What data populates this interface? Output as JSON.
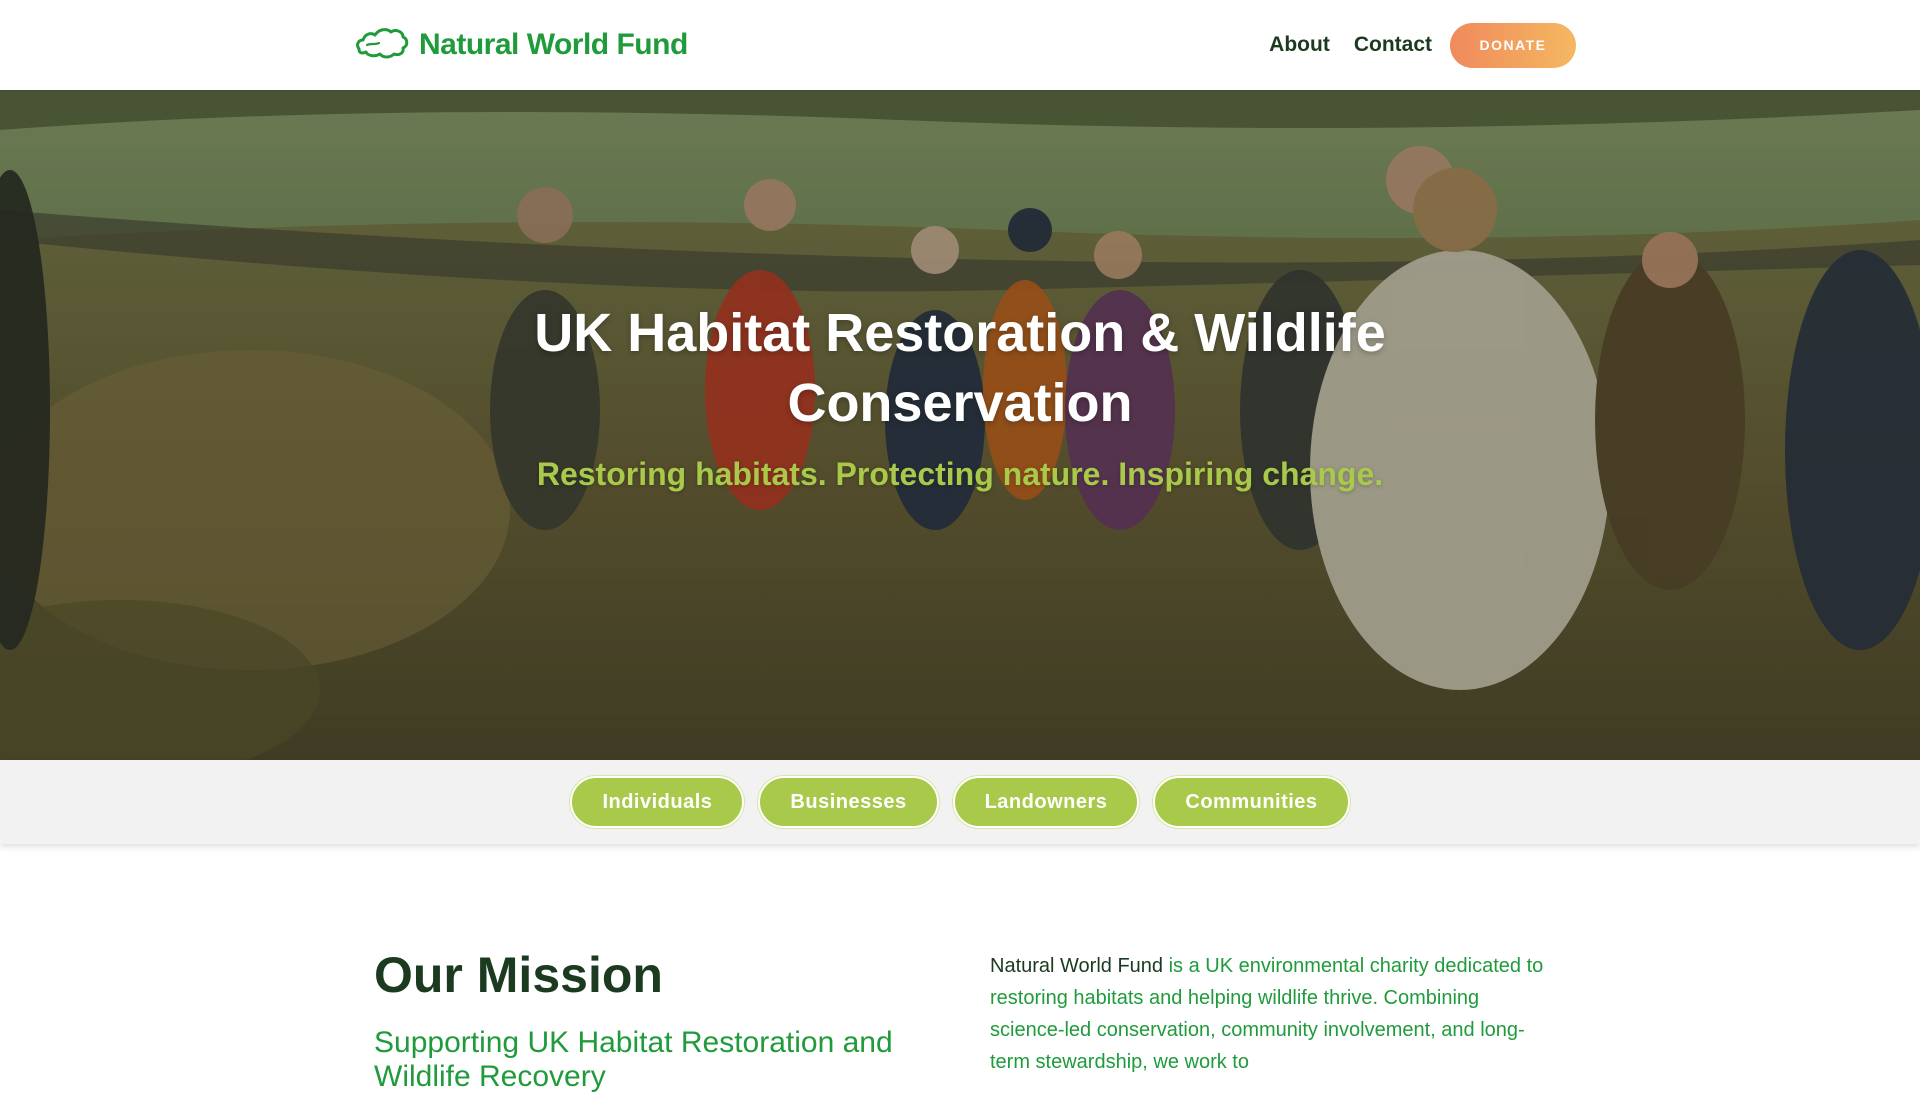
{
  "header": {
    "brand_name": "Natural World Fund",
    "nav": [
      {
        "label": "About"
      },
      {
        "label": "Contact"
      }
    ],
    "donate_label": "DONATE"
  },
  "hero": {
    "title": "UK Habitat Restoration & Wildlife Conservation",
    "subtitle": "Restoring habitats. Protecting nature. Inspiring change."
  },
  "audience": [
    {
      "label": "Individuals"
    },
    {
      "label": "Businesses"
    },
    {
      "label": "Landowners"
    },
    {
      "label": "Communities"
    }
  ],
  "mission": {
    "heading": "Our Mission",
    "subheading": "Supporting UK Habitat Restoration and Wildlife Recovery",
    "body_org": "Natural World Fund",
    "body_text": " is a UK environmental charity dedicated to restoring habitats and helping wildlife thrive. Combining science-led conservation, community involvement, and long-term stewardship, we work to"
  },
  "colors": {
    "brand_green": "#1f9b3c",
    "dark_green": "#1b3a1f",
    "lime": "#a8c94a",
    "donate_start": "#f08a5d",
    "donate_end": "#f4b860"
  },
  "icons": {
    "logo": "uk-map-outline-icon"
  }
}
